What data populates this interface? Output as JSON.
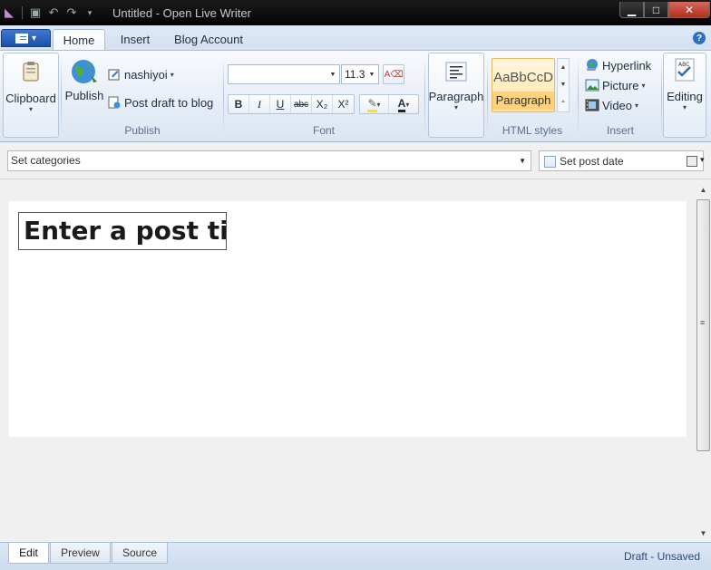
{
  "window": {
    "title": "Untitled - Open Live Writer",
    "minimize_glyph": "▁",
    "maximize_glyph": "□",
    "close_glyph": "✕"
  },
  "tabs": [
    {
      "label": "Home",
      "active": true
    },
    {
      "label": "Insert"
    },
    {
      "label": "Blog Account"
    }
  ],
  "help_glyph": "?",
  "ribbon": {
    "clipboard": {
      "label": "Clipboard"
    },
    "publish_group": {
      "label": "Publish",
      "publish_button": "Publish",
      "account_name": "nashiyoi",
      "post_draft": "Post draft to blog"
    },
    "font_group": {
      "label": "Font",
      "font_name": "",
      "font_size": "11.3",
      "buttons": [
        "B",
        "I",
        "U",
        "abc",
        "X₂",
        "X²"
      ]
    },
    "paragraph_group": {
      "label": "Paragraph"
    },
    "styles_group": {
      "label": "HTML styles",
      "sample": "AaBbCcD",
      "style_name": "Paragraph"
    },
    "insert_group": {
      "label": "Insert",
      "hyperlink": "Hyperlink",
      "picture": "Picture",
      "video": "Video"
    },
    "editing_group": {
      "label": "Editing"
    }
  },
  "category_bar": {
    "categories_placeholder": "Set categories",
    "post_date_label": "Set post date"
  },
  "editor": {
    "title_placeholder": "Enter a post title"
  },
  "view_tabs": [
    {
      "label": "Edit",
      "active": true
    },
    {
      "label": "Preview"
    },
    {
      "label": "Source"
    }
  ],
  "status_text": "Draft - Unsaved",
  "colors": {
    "accent": "#2d6fc5",
    "style_highlight": "#ffd27a"
  }
}
